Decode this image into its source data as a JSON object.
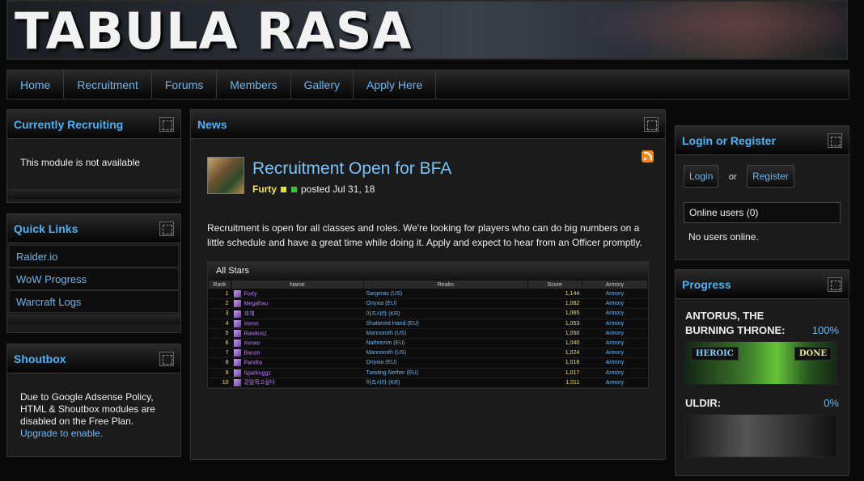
{
  "banner": {
    "title": "TABULA RASA"
  },
  "nav": {
    "items": [
      {
        "label": "Home"
      },
      {
        "label": "Recruitment"
      },
      {
        "label": "Forums"
      },
      {
        "label": "Members"
      },
      {
        "label": "Gallery"
      },
      {
        "label": "Apply Here"
      }
    ]
  },
  "recruiting": {
    "title": "Currently Recruiting",
    "message": "This module is not available"
  },
  "quick_links": {
    "title": "Quick Links",
    "items": [
      {
        "label": "Raider.io"
      },
      {
        "label": "WoW Progress"
      },
      {
        "label": "Warcraft Logs"
      }
    ]
  },
  "shoutbox": {
    "title": "Shoutbox",
    "message": "Due to Google Adsense Policy, HTML & Shoutbox modules are disabled on the Free Plan.",
    "link": "Upgrade to enable."
  },
  "news": {
    "title": "News",
    "post_title": "Recruitment Open for BFA",
    "author": "Furty",
    "posted": "posted Jul 31, 18",
    "body": "Recruitment is open for all classes and roles. We're looking for players who can do big numbers on a little schedule and have a great time while doing it. Apply and expect to hear from an Officer promptly.",
    "badge_colors": [
      "#e8e02a",
      "#39c13a"
    ],
    "stars": {
      "title": "All Stars",
      "columns": [
        "Rank",
        "Name",
        "Realm",
        "Score",
        "Armory"
      ],
      "rows": [
        {
          "rank": "1",
          "name": "Furty",
          "realm": "Sargeras (US)",
          "score": "1,144",
          "armory": "Armory"
        },
        {
          "rank": "2",
          "name": "Megafrau",
          "realm": "Onyxia (EU)",
          "score": "1,082",
          "armory": "Armory"
        },
        {
          "rank": "3",
          "name": "꾀혜",
          "realm": "아즈샤라 (KR)",
          "score": "1,065",
          "armory": "Armory"
        },
        {
          "rank": "4",
          "name": "Xemn",
          "realm": "Shattered Hand (EU)",
          "score": "1,053",
          "armory": "Armory"
        },
        {
          "rank": "5",
          "name": "Rawkusz",
          "realm": "Mannoroth (US)",
          "score": "1,050",
          "armory": "Armory"
        },
        {
          "rank": "6",
          "name": "Xerwo",
          "realm": "Nathrezim (EU)",
          "score": "1,040",
          "armory": "Armory"
        },
        {
          "rank": "7",
          "name": "Bacon",
          "realm": "Mannoroth (US)",
          "score": "1,024",
          "armory": "Armory"
        },
        {
          "rank": "8",
          "name": "Pandra",
          "realm": "Onyxia (EU)",
          "score": "1,018",
          "armory": "Armory"
        },
        {
          "rank": "9",
          "name": "Sparkuggz",
          "realm": "Twisting Nether (EU)",
          "score": "1,017",
          "armory": "Armory"
        },
        {
          "rank": "10",
          "name": "강말목고싶다",
          "realm": "아즈샤라 (KR)",
          "score": "1,011",
          "armory": "Armory"
        }
      ]
    }
  },
  "login": {
    "title": "Login or Register",
    "login_label": "Login",
    "or_text": "or",
    "register_label": "Register",
    "online_users": "Online users (0)",
    "no_users": "No users online."
  },
  "progress": {
    "title": "Progress",
    "raids": [
      {
        "name": "ANTORUS, THE BURNING THRONE:",
        "percent": "100%",
        "difficulty": "HEROIC",
        "status": "DONE"
      },
      {
        "name": "ULDIR:",
        "percent": "0%"
      }
    ]
  }
}
